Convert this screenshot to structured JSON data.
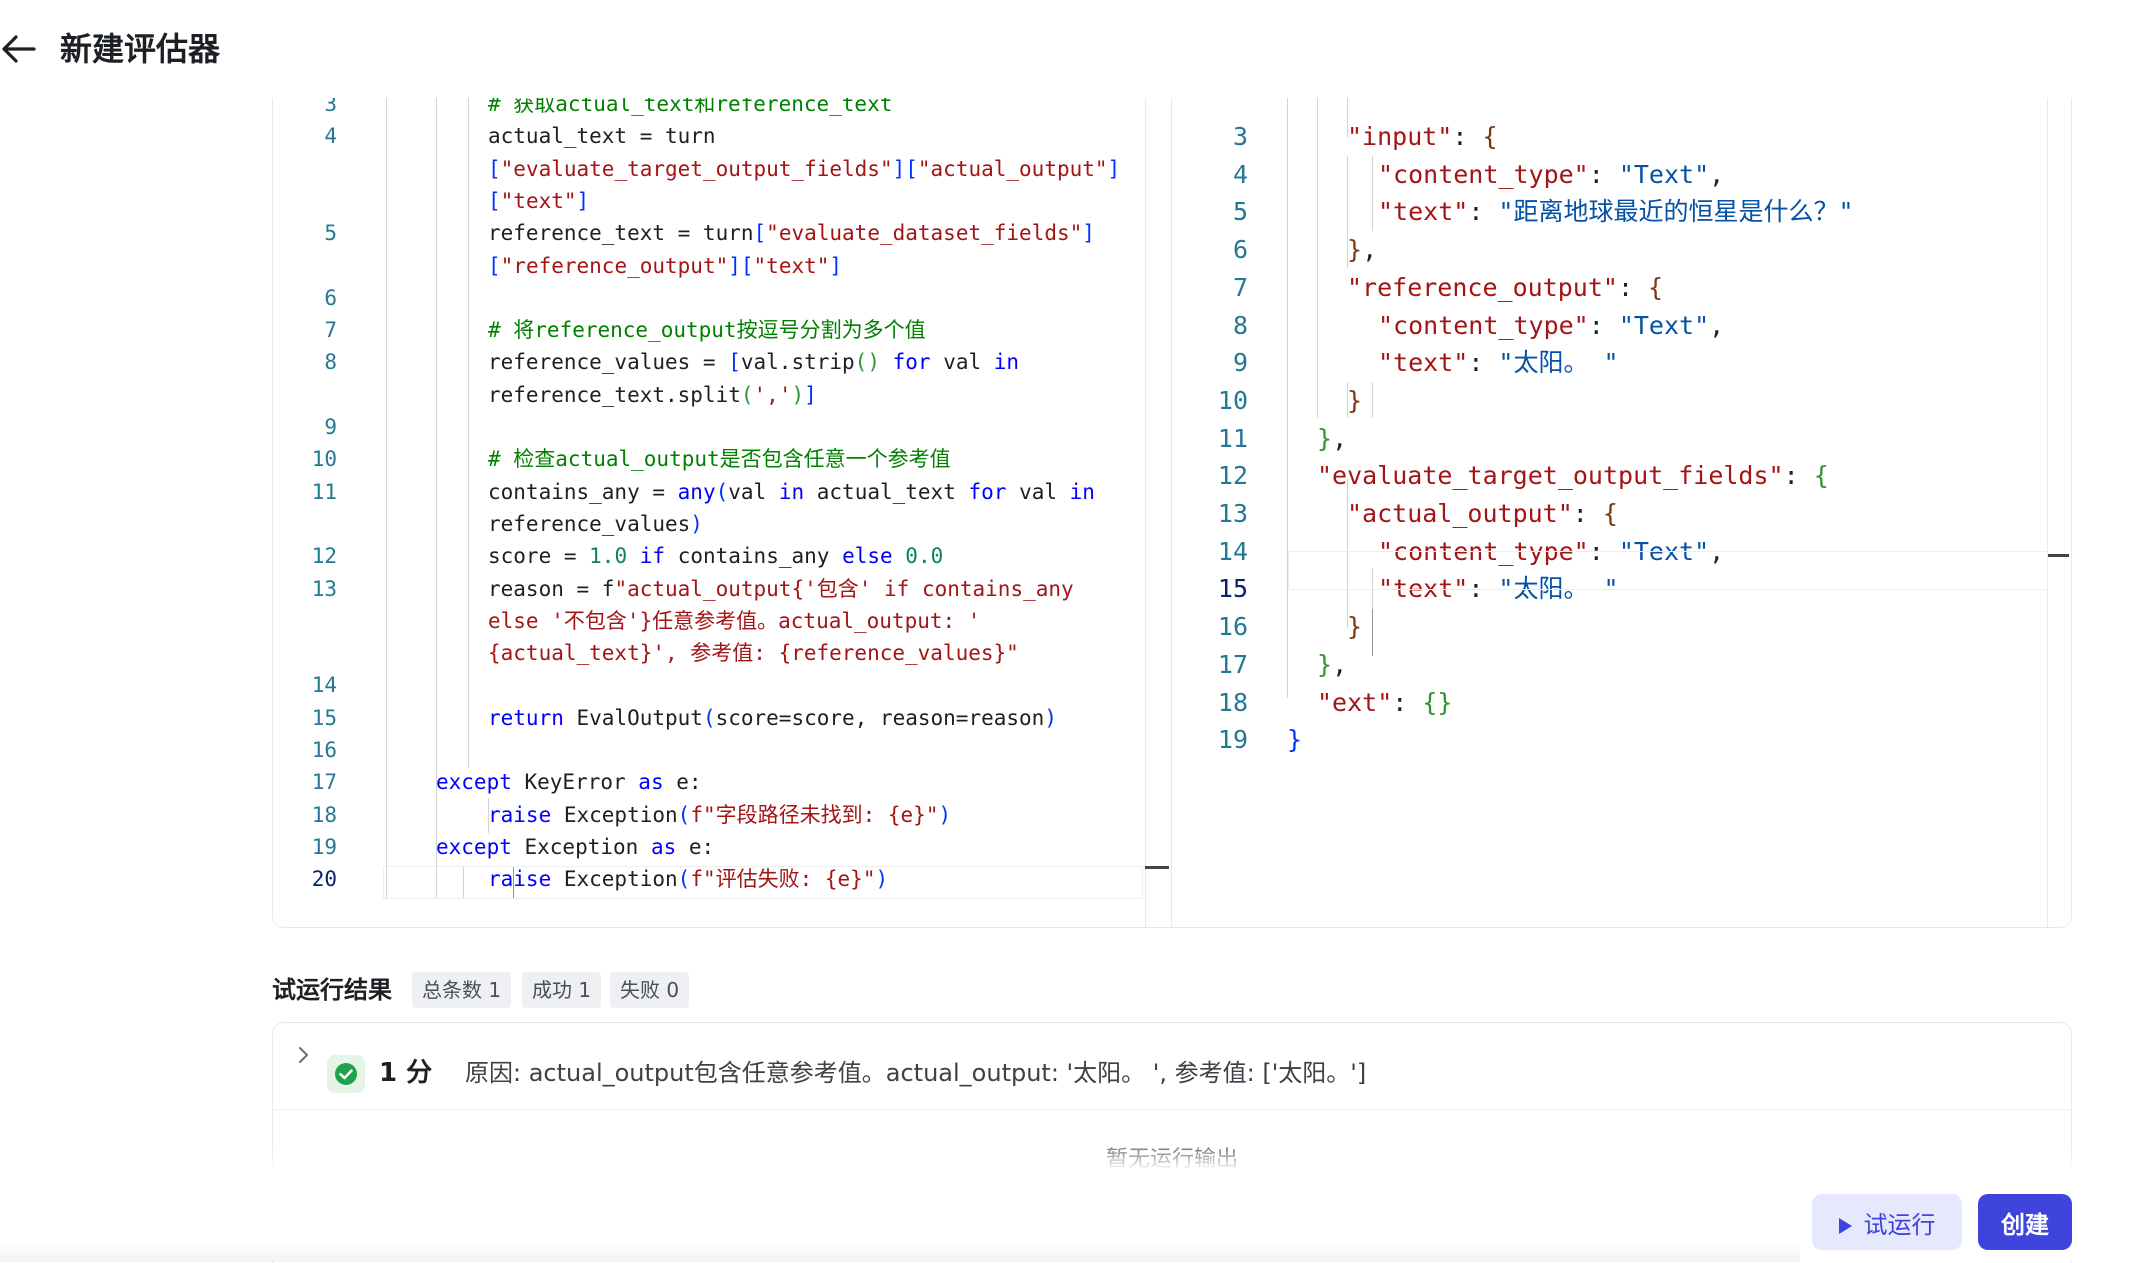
{
  "header": {
    "title": "新建评估器"
  },
  "code_editor": {
    "lines": [
      {
        "num": "3",
        "tokens": [
          {
            "t": "# 获取actual_text和reference_text",
            "c": "c"
          }
        ]
      },
      {
        "num": "4",
        "tokens": [
          {
            "t": "actual_text = turn"
          }
        ]
      },
      {
        "num": "",
        "tokens": [
          {
            "t": "[",
            "c": "b1"
          },
          {
            "t": "\"evaluate_target_output_fields\"",
            "c": "s"
          },
          {
            "t": "][",
            "c": "b1"
          },
          {
            "t": "\"actual_output\"",
            "c": "s"
          },
          {
            "t": "]",
            "c": "b1"
          }
        ]
      },
      {
        "num": "",
        "tokens": [
          {
            "t": "[",
            "c": "b1"
          },
          {
            "t": "\"text\"",
            "c": "s"
          },
          {
            "t": "]",
            "c": "b1"
          }
        ]
      },
      {
        "num": "5",
        "tokens": [
          {
            "t": "reference_text = turn"
          },
          {
            "t": "[",
            "c": "b1"
          },
          {
            "t": "\"evaluate_dataset_fields\"",
            "c": "s"
          },
          {
            "t": "]",
            "c": "b1"
          }
        ]
      },
      {
        "num": "",
        "tokens": [
          {
            "t": "[",
            "c": "b1"
          },
          {
            "t": "\"reference_output\"",
            "c": "s"
          },
          {
            "t": "][",
            "c": "b1"
          },
          {
            "t": "\"text\"",
            "c": "s"
          },
          {
            "t": "]",
            "c": "b1"
          }
        ]
      },
      {
        "num": "6",
        "tokens": []
      },
      {
        "num": "7",
        "tokens": [
          {
            "t": "# 将reference_output按逗号分割为多个值",
            "c": "c"
          }
        ]
      },
      {
        "num": "8",
        "tokens": [
          {
            "t": "reference_values = "
          },
          {
            "t": "[",
            "c": "b1"
          },
          {
            "t": "val.strip"
          },
          {
            "t": "()",
            "c": "b2"
          },
          {
            "t": " "
          },
          {
            "t": "for",
            "c": "k"
          },
          {
            "t": " val "
          },
          {
            "t": "in",
            "c": "k"
          }
        ]
      },
      {
        "num": "",
        "tokens": [
          {
            "t": "reference_text.split"
          },
          {
            "t": "(",
            "c": "b2"
          },
          {
            "t": "','",
            "c": "s"
          },
          {
            "t": ")",
            "c": "b2"
          },
          {
            "t": "]",
            "c": "b1"
          }
        ]
      },
      {
        "num": "9",
        "tokens": []
      },
      {
        "num": "10",
        "tokens": [
          {
            "t": "# 检查actual_output是否包含任意一个参考值",
            "c": "c"
          }
        ]
      },
      {
        "num": "11",
        "tokens": [
          {
            "t": "contains_any = "
          },
          {
            "t": "any",
            "c": "k"
          },
          {
            "t": "(",
            "c": "b1"
          },
          {
            "t": "val "
          },
          {
            "t": "in",
            "c": "k"
          },
          {
            "t": " actual_text "
          },
          {
            "t": "for",
            "c": "k"
          },
          {
            "t": " val "
          },
          {
            "t": "in",
            "c": "k"
          }
        ]
      },
      {
        "num": "",
        "tokens": [
          {
            "t": "reference_values"
          },
          {
            "t": ")",
            "c": "b1"
          }
        ]
      },
      {
        "num": "12",
        "tokens": [
          {
            "t": "score = "
          },
          {
            "t": "1.0",
            "c": "n"
          },
          {
            "t": " "
          },
          {
            "t": "if",
            "c": "k"
          },
          {
            "t": " contains_any "
          },
          {
            "t": "else",
            "c": "k"
          },
          {
            "t": " "
          },
          {
            "t": "0.0",
            "c": "n"
          }
        ]
      },
      {
        "num": "13",
        "tokens": [
          {
            "t": "reason = f"
          },
          {
            "t": "\"actual_output{'包含' if contains_any",
            "c": "s"
          }
        ]
      },
      {
        "num": "",
        "tokens": [
          {
            "t": "else '不包含'}任意参考值。actual_output: '",
            "c": "s"
          }
        ]
      },
      {
        "num": "",
        "tokens": [
          {
            "t": "{actual_text}', 参考值: {reference_values}\"",
            "c": "s"
          }
        ]
      },
      {
        "num": "14",
        "tokens": []
      },
      {
        "num": "15",
        "tokens": [
          {
            "t": "return",
            "c": "k"
          },
          {
            "t": " EvalOutput"
          },
          {
            "t": "(",
            "c": "b1"
          },
          {
            "t": "score=score, reason=reason"
          },
          {
            "t": ")",
            "c": "b1"
          }
        ]
      },
      {
        "num": "16",
        "tokens": []
      },
      {
        "num": "17",
        "tokens": [
          {
            "t": "except",
            "c": "k"
          },
          {
            "t": " KeyError "
          },
          {
            "t": "as",
            "c": "k"
          },
          {
            "t": " e:"
          }
        ]
      },
      {
        "num": "18",
        "tokens": [
          {
            "t": "raise",
            "c": "k"
          },
          {
            "t": " Exception"
          },
          {
            "t": "(",
            "c": "b1"
          },
          {
            "t": "f\"字段路径未找到: {e}\"",
            "c": "s"
          },
          {
            "t": ")",
            "c": "b1"
          }
        ]
      },
      {
        "num": "19",
        "tokens": [
          {
            "t": "except",
            "c": "k"
          },
          {
            "t": " Exception "
          },
          {
            "t": "as",
            "c": "k"
          },
          {
            "t": " e:"
          }
        ]
      },
      {
        "num": "20",
        "tokens": [
          {
            "t": "raise",
            "c": "k"
          },
          {
            "t": " Exception"
          },
          {
            "t": "(",
            "c": "b1"
          },
          {
            "t": "f\"评估失败: {e}\"",
            "c": "s"
          },
          {
            "t": ")",
            "c": "b1"
          }
        ]
      }
    ]
  },
  "json_editor": {
    "lines": [
      {
        "num": "3",
        "tokens": [
          {
            "t": "\"input\"",
            "c": "pk"
          },
          {
            "t": ": "
          },
          {
            "t": "{",
            "c": "b3"
          }
        ]
      },
      {
        "num": "4",
        "tokens": [
          {
            "t": "\"content_type\"",
            "c": "pk"
          },
          {
            "t": ": "
          },
          {
            "t": "\"Text\"",
            "c": "pv"
          },
          {
            "t": ","
          }
        ]
      },
      {
        "num": "5",
        "tokens": [
          {
            "t": "\"text\"",
            "c": "pk"
          },
          {
            "t": ": "
          },
          {
            "t": "\"距离地球最近的恒星是什么？\"",
            "c": "pv"
          }
        ]
      },
      {
        "num": "6",
        "tokens": [
          {
            "t": "}",
            "c": "b3"
          },
          {
            "t": ","
          }
        ]
      },
      {
        "num": "7",
        "tokens": [
          {
            "t": "\"reference_output\"",
            "c": "pk"
          },
          {
            "t": ": "
          },
          {
            "t": "{",
            "c": "b3"
          }
        ]
      },
      {
        "num": "8",
        "tokens": [
          {
            "t": "\"content_type\"",
            "c": "pk"
          },
          {
            "t": ": "
          },
          {
            "t": "\"Text\"",
            "c": "pv"
          },
          {
            "t": ","
          }
        ]
      },
      {
        "num": "9",
        "tokens": [
          {
            "t": "\"text\"",
            "c": "pk"
          },
          {
            "t": ": "
          },
          {
            "t": "\"太阳。 \"",
            "c": "pv"
          }
        ]
      },
      {
        "num": "10",
        "tokens": [
          {
            "t": "}",
            "c": "b3"
          }
        ]
      },
      {
        "num": "11",
        "tokens": [
          {
            "t": "}",
            "c": "b2"
          },
          {
            "t": ","
          }
        ]
      },
      {
        "num": "12",
        "tokens": [
          {
            "t": "\"evaluate_target_output_fields\"",
            "c": "pk"
          },
          {
            "t": ": "
          },
          {
            "t": "{",
            "c": "b2"
          }
        ]
      },
      {
        "num": "13",
        "tokens": [
          {
            "t": "\"actual_output\"",
            "c": "pk"
          },
          {
            "t": ": "
          },
          {
            "t": "{",
            "c": "b3"
          }
        ]
      },
      {
        "num": "14",
        "tokens": [
          {
            "t": "\"content_type\"",
            "c": "pk"
          },
          {
            "t": ": "
          },
          {
            "t": "\"Text\"",
            "c": "pv"
          },
          {
            "t": ","
          }
        ]
      },
      {
        "num": "15",
        "tokens": [
          {
            "t": "\"text\"",
            "c": "pk"
          },
          {
            "t": ": "
          },
          {
            "t": "\"太阳。 \"",
            "c": "pv"
          }
        ]
      },
      {
        "num": "16",
        "tokens": [
          {
            "t": "}",
            "c": "b3"
          }
        ]
      },
      {
        "num": "17",
        "tokens": [
          {
            "t": "}",
            "c": "b2"
          },
          {
            "t": ","
          }
        ]
      },
      {
        "num": "18",
        "tokens": [
          {
            "t": "\"ext\"",
            "c": "pk"
          },
          {
            "t": ": "
          },
          {
            "t": "{}",
            "c": "b2"
          }
        ]
      },
      {
        "num": "19",
        "tokens": [
          {
            "t": "}",
            "c": "b1"
          }
        ]
      }
    ]
  },
  "results": {
    "title": "试运行结果",
    "total": "总条数 1",
    "success": "成功 1",
    "fail": "失败 0",
    "item": {
      "score": "1 分",
      "reason": "原因: actual_output包含任意参考值。actual_output: '太阳。 ', 参考值: ['太阳。']",
      "next_label": "暂无运行输出"
    }
  },
  "footer": {
    "trial_label": "试运行",
    "create_label": "创建"
  },
  "colors": {
    "accent": "#3f44dc",
    "accent_light": "#e6e8fd",
    "success": "#1fa24a"
  },
  "icons": [
    "arrow-left-icon",
    "chevron-right-icon",
    "check-circle-icon",
    "play-icon"
  ]
}
